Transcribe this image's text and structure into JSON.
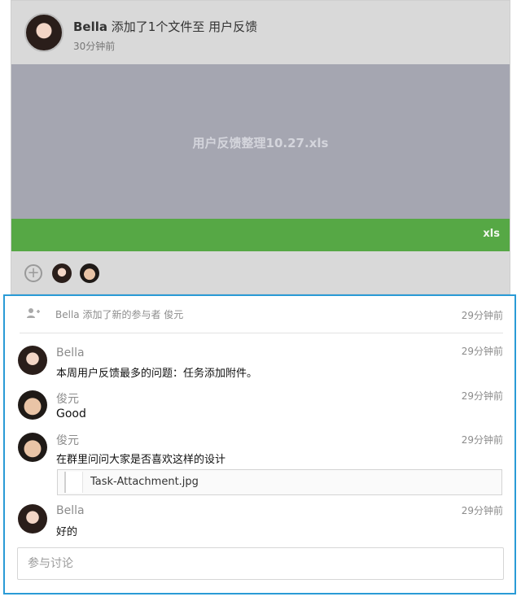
{
  "activity_card": {
    "actor": "Bella",
    "action_text": "添加了1个文件至 用户反馈",
    "time": "30分钟前",
    "file_preview_name": "用户反馈整理10.27.xls",
    "file_type": "xls",
    "add_icon": "plus-circle-icon"
  },
  "discussion": {
    "activity": {
      "icon": "add-user-icon",
      "text": "Bella 添加了新的参与者  俊元",
      "time": "29分钟前"
    },
    "comments": [
      {
        "author": "Bella",
        "time": "29分钟前",
        "text": "本周用户反馈最多的问题：任务添加附件。"
      },
      {
        "author": "俊元",
        "time": "29分钟前",
        "text": "Good"
      },
      {
        "author": "俊元",
        "time": "29分钟前",
        "text": "在群里问问大家是否喜欢这样的设计",
        "attachment": "Task-Attachment.jpg"
      },
      {
        "author": "Bella",
        "time": "29分钟前",
        "text": "好的"
      }
    ],
    "input_placeholder": "参与讨论"
  },
  "colors": {
    "file_bar": "#56a845",
    "preview_bg": "#a5a6b1",
    "focus_border": "#2a9bd6"
  }
}
